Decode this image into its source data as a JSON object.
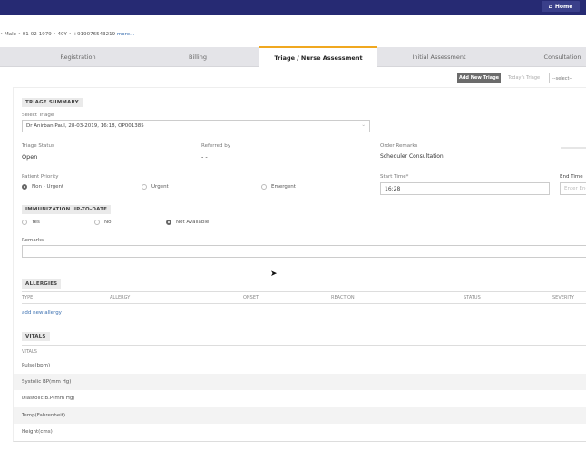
{
  "header": {
    "home_label": "Home"
  },
  "patient": {
    "info": "• Male  •  01-02-1979  •  40Y  •  +919076543219",
    "more": "more..."
  },
  "tabs": [
    {
      "label": "Registration"
    },
    {
      "label": "Billing"
    },
    {
      "label": "Triage / Nurse Assessment",
      "active": true
    },
    {
      "label": "Initial Assessment"
    },
    {
      "label": "Consultation"
    }
  ],
  "toolbar": {
    "add_triage": "Add New Triage",
    "todays_triage_label": "Today's Triage",
    "todays_triage_value": "--select--"
  },
  "triage_summary": {
    "title": "TRIAGE SUMMARY",
    "select_label": "Select Triage",
    "select_value": "Dr Anirban Paul, 28-03-2019, 16:18, OP001385",
    "status_label": "Triage Status",
    "status_value": "Open",
    "referred_label": "Referred by",
    "referred_value": "- -",
    "order_label": "Order Remarks",
    "order_value": "Scheduler Consultation",
    "priority_label": "Patient Priority",
    "priority_options": [
      "Non - Urgent",
      "Urgent",
      "Emergent"
    ],
    "start_label": "Start Time*",
    "start_value": "16:28",
    "end_label": "End Time",
    "end_placeholder": "Enter End Time"
  },
  "immunization": {
    "title": "IMMUNIZATION UP-TO-DATE",
    "options": [
      "Yes",
      "No",
      "Not Available"
    ]
  },
  "remarks": {
    "label": "Remarks",
    "value": ""
  },
  "allergies": {
    "title": "ALLERGIES",
    "columns": [
      "TYPE",
      "ALLERGY",
      "ONSET",
      "REACTION",
      "STATUS",
      "SEVERITY"
    ],
    "add_link": "add new allergy"
  },
  "vitals": {
    "title": "VITALS",
    "header": "VITALS",
    "rows": [
      "Pulse(bpm)",
      "Systolic BP(mm Hg)",
      "Diastolic B.P(mm Hg)",
      "Temp(Fahrenheit)",
      "Height(cms)"
    ]
  }
}
